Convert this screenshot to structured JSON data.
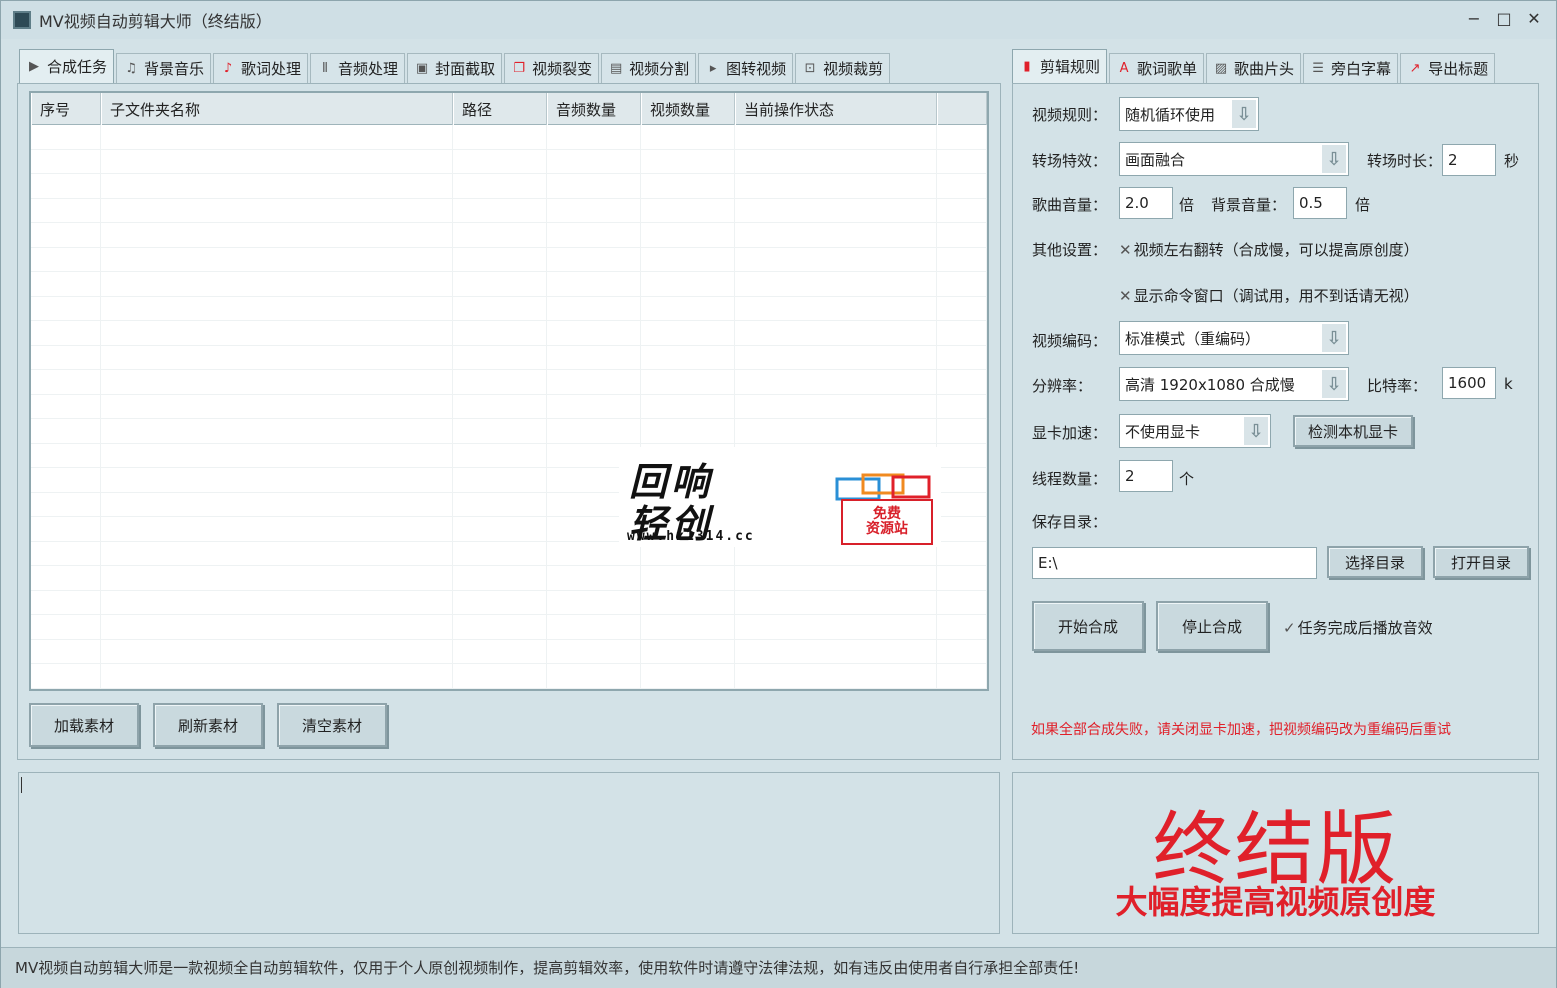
{
  "window": {
    "title": "MV视频自动剪辑大师（终结版）",
    "controls": [
      "−",
      "□",
      "✕"
    ]
  },
  "left_tabs": [
    {
      "label": "合成任务",
      "icon": "play-icon",
      "glyph": "▶",
      "active": true
    },
    {
      "label": "背景音乐",
      "icon": "music-note-icon",
      "glyph": "♫",
      "active": false
    },
    {
      "label": "歌词处理",
      "icon": "lyrics-icon",
      "glyph": "♪",
      "active": false
    },
    {
      "label": "音频处理",
      "icon": "audio-wave-icon",
      "glyph": "⦀",
      "active": false
    },
    {
      "label": "封面截取",
      "icon": "image-icon",
      "glyph": "▣",
      "active": false
    },
    {
      "label": "视频裂变",
      "icon": "copy-icon",
      "glyph": "❐",
      "active": false
    },
    {
      "label": "视频分割",
      "icon": "film-icon",
      "glyph": "▤",
      "active": false
    },
    {
      "label": "图转视频",
      "icon": "slideshow-icon",
      "glyph": "▸",
      "active": false
    },
    {
      "label": "视频裁剪",
      "icon": "crop-icon",
      "glyph": "⊡",
      "active": false
    }
  ],
  "table": {
    "columns": [
      "序号",
      "子文件夹名称",
      "路径",
      "音频数量",
      "视频数量",
      "当前操作状态"
    ],
    "rows": []
  },
  "left_buttons": {
    "load": "加载素材",
    "refresh": "刷新素材",
    "clear": "清空素材"
  },
  "right_tabs": [
    {
      "label": "剪辑规则",
      "icon": "film-strip-icon",
      "glyph": "▮",
      "active": true
    },
    {
      "label": "歌词歌单",
      "icon": "font-icon",
      "glyph": "A",
      "active": false
    },
    {
      "label": "歌曲片头",
      "icon": "picture-icon",
      "glyph": "▨",
      "active": false
    },
    {
      "label": "旁白字幕",
      "icon": "document-icon",
      "glyph": "☰",
      "active": false
    },
    {
      "label": "导出标题",
      "icon": "export-icon",
      "glyph": "↗",
      "active": false
    }
  ],
  "settings": {
    "video_rule_label": "视频规则：",
    "video_rule_value": "随机循环使用",
    "transition_label": "转场特效：",
    "transition_value": "画面融合",
    "transition_duration_label": "转场时长：",
    "transition_duration_value": "2",
    "transition_duration_unit": "秒",
    "song_volume_label": "歌曲音量：",
    "song_volume_value": "2.0",
    "song_volume_unit": "倍",
    "bg_volume_label": "背景音量：",
    "bg_volume_value": "0.5",
    "bg_volume_unit": "倍",
    "other_label": "其他设置：",
    "flip_option": "视频左右翻转（合成慢，可以提高原创度）",
    "flip_checked": false,
    "cmd_option": "显示命令窗口（调试用，用不到话请无视）",
    "cmd_checked": false,
    "encode_label": "视频编码：",
    "encode_value": "标准模式（重编码）",
    "resolution_label": "分辨率：",
    "resolution_value": "高清 1920x1080 合成慢",
    "bitrate_label": "比特率：",
    "bitrate_value": "1600",
    "bitrate_unit": "k",
    "gpu_label": "显卡加速：",
    "gpu_value": "不使用显卡",
    "detect_gpu_button": "检测本机显卡",
    "threads_label": "线程数量：",
    "threads_value": "2",
    "threads_unit": "个",
    "save_dir_label": "保存目录：",
    "save_dir_value": "E:\\",
    "choose_dir_button": "选择目录",
    "open_dir_button": "打开目录",
    "start_button": "开始合成",
    "stop_button": "停止合成",
    "sound_option": "任务完成后播放音效",
    "sound_checked": true,
    "warning": "如果全部合成失败，请关闭显卡加速，把视频编码改为重编码后重试"
  },
  "promo": {
    "title": "终结版",
    "subtitle": "大幅度提高视频原创度"
  },
  "watermark": {
    "line1": "回响",
    "line2": "轻创",
    "url": "www.hx1314.cc",
    "stamp_line1": "免费",
    "stamp_line2": "资源站"
  },
  "status": {
    "text": "MV视频自动剪辑大师是一款视频全自动剪辑软件，仅用于个人原创视频制作，提高剪辑效率，使用软件时请遵守法律法规，如有违反由使用者自行承担全部责任!"
  },
  "colors": {
    "accent_red": "#e0202a",
    "background": "#d3e2e7"
  }
}
